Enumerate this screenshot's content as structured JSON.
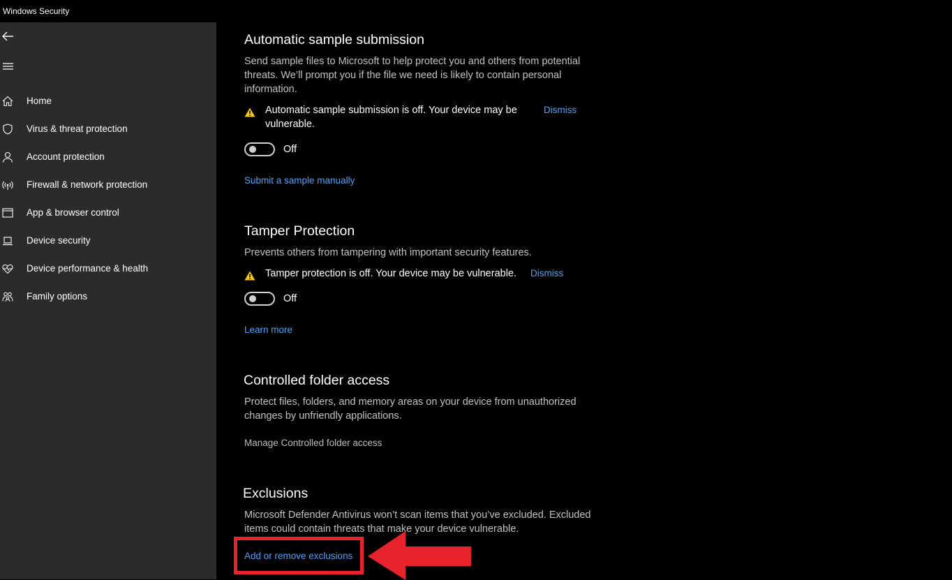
{
  "window": {
    "title": "Windows Security"
  },
  "sidebar": {
    "back_icon": "back-arrow-icon",
    "menu_icon": "hamburger-menu-icon",
    "items": [
      {
        "label": "Home",
        "icon": "home-icon"
      },
      {
        "label": "Virus & threat protection",
        "icon": "shield-icon"
      },
      {
        "label": "Account protection",
        "icon": "person-icon"
      },
      {
        "label": "Firewall & network protection",
        "icon": "wireless-antenna-icon"
      },
      {
        "label": "App & browser control",
        "icon": "browser-window-icon"
      },
      {
        "label": "Device security",
        "icon": "laptop-icon"
      },
      {
        "label": "Device performance & health",
        "icon": "heart-pulse-icon"
      },
      {
        "label": "Family options",
        "icon": "family-icon"
      }
    ]
  },
  "sections": {
    "sample_submission": {
      "title": "Automatic sample submission",
      "description": "Send sample files to Microsoft to help protect you and others from potential threats. We’ll prompt you if the file we need is likely to contain personal information.",
      "warning": "Automatic sample submission is off. Your device may be vulnerable.",
      "dismiss": "Dismiss",
      "toggle_state": "Off",
      "link": "Submit a sample manually"
    },
    "tamper_protection": {
      "title": "Tamper Protection",
      "description": "Prevents others from tampering with important security features.",
      "warning": "Tamper protection is off. Your device may be vulnerable.",
      "dismiss": "Dismiss",
      "toggle_state": "Off",
      "link": "Learn more"
    },
    "controlled_folder_access": {
      "title": "Controlled folder access",
      "description": "Protect files, folders, and memory areas on your device from unauthorized changes by unfriendly applications.",
      "link": "Manage Controlled folder access"
    },
    "exclusions": {
      "title": "Exclusions",
      "description": "Microsoft Defender Antivirus won’t scan items that you’ve excluded. Excluded items could contain threats that make your device vulnerable.",
      "link": "Add or remove exclusions"
    }
  },
  "annotation": {
    "highlight_color": "#e8232b",
    "pointer": "red-arrow-pointing-left"
  },
  "colors": {
    "sidebar_bg": "#2b2b2b",
    "main_bg": "#000000",
    "link": "#4fa2f5",
    "warning": "#f5c518"
  }
}
